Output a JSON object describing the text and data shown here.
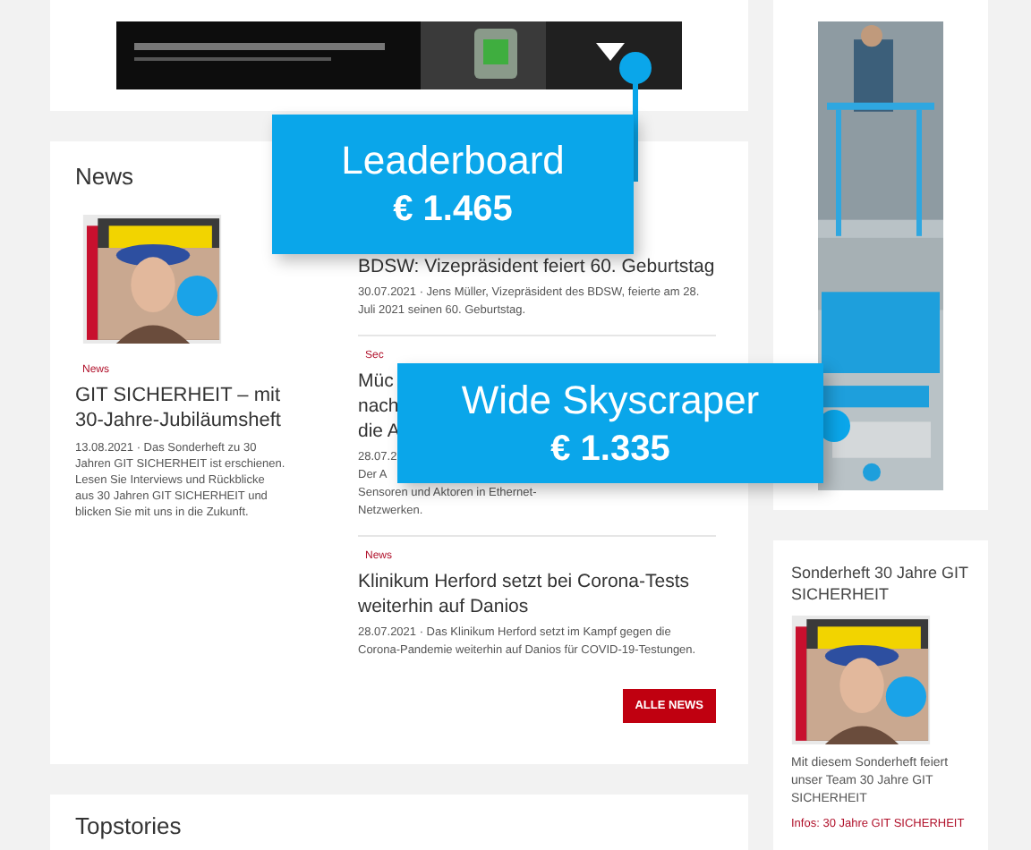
{
  "news": {
    "title": "News",
    "lead": {
      "tag": "News",
      "title": "GIT SICHERHEIT – mit 30-Jahre-Jubiläumsheft",
      "body": "13.08.2021 · Das Sonderheft zu 30 Jahren GIT SICHERHEIT ist erschienen. Lesen Sie Interviews und Rückblicke aus 30 Jahren GIT SICHERHEIT und blicken Sie mit uns in die Zukunft."
    },
    "items": [
      {
        "kind": "full",
        "title": "BDSW: Vizepräsident feiert 60. Geburtstag",
        "body": "30.07.2021 · Jens Müller, Vizepräsident des BDSW, feierte am 28. Juli 2021 seinen 60. Geburtstag."
      },
      {
        "kind": "covered",
        "tag": "Sec",
        "title_lines": [
          "Müc",
          "nach",
          "die A"
        ],
        "body_lines": [
          "28.07.2",
          "Der A",
          "Sensoren und Aktoren in Ethernet-",
          "Netzwerken."
        ]
      },
      {
        "kind": "full",
        "tag": "News",
        "title": "Klinikum Herford setzt bei Corona-Tests weiterhin auf Danios",
        "body": "28.07.2021 · Das Klinikum Herford setzt im Kampf gegen die Corona-Pandemie weiterhin auf Danios für COVID-19-Testungen."
      }
    ],
    "button": "ALLE NEWS"
  },
  "topstories": {
    "title": "Topstories"
  },
  "sidebar": {
    "title": "Sonderheft 30 Jahre GIT SICHERHEIT",
    "text": "Mit diesem Sonderheft feiert unser Team 30 Jahre GIT SICHERHEIT",
    "link": "Infos: 30 Jahre GIT SICHERHEIT"
  },
  "callouts": [
    {
      "name": "Leaderboard",
      "price": "€ 1.465"
    },
    {
      "name": "Wide Skyscraper",
      "price": "€ 1.335"
    }
  ]
}
